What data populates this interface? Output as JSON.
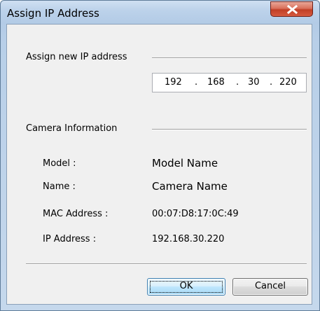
{
  "window": {
    "title": "Assign IP Address"
  },
  "assign_group": {
    "label": "Assign new IP address",
    "ip_octets": [
      "192",
      "168",
      "30",
      "220"
    ]
  },
  "camera_group": {
    "label": "Camera Information",
    "rows": [
      {
        "label": "Model :",
        "value": "Model Name"
      },
      {
        "label": "Name :",
        "value": "Camera Name"
      },
      {
        "label": "MAC Address :",
        "value": "00:07:D8:17:0C:49"
      },
      {
        "label": "IP Address :",
        "value": "192.168.30.220"
      }
    ]
  },
  "buttons": {
    "ok": "OK",
    "cancel": "Cancel"
  },
  "colors": {
    "close_button": "#c9492f",
    "ok_border": "#3c7fb1",
    "dialog_background": "#f0f0f0"
  },
  "icons": {
    "close": "x-close-icon"
  }
}
